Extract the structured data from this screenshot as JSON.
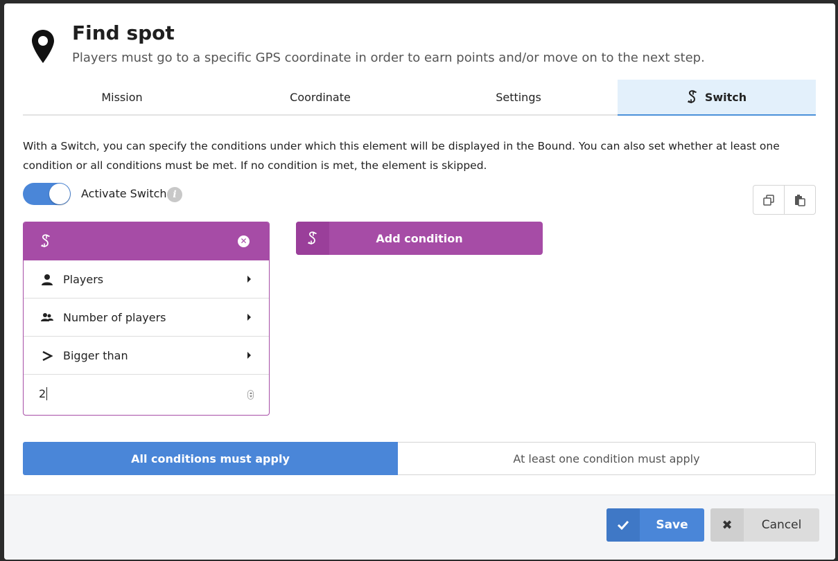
{
  "header": {
    "icon": "map-pin-icon",
    "title": "Find spot",
    "subtitle": "Players must go to a specific GPS coordinate in order to earn points and/or move on to the next step."
  },
  "tabs": [
    {
      "label": "Mission",
      "active": false
    },
    {
      "label": "Coordinate",
      "active": false
    },
    {
      "label": "Settings",
      "active": false
    },
    {
      "label": "Switch",
      "active": true,
      "icon": "switch-icon"
    }
  ],
  "switch": {
    "intro": "With a Switch, you can specify the conditions under which this element will be displayed in the Bound. You can also set whether at least one condition or all conditions must be met. If no condition is met, the element is skipped.",
    "toggle_label": "Activate Switch",
    "toggle_on": true,
    "info_glyph": "i"
  },
  "condition": {
    "rows": [
      {
        "icon": "user-icon",
        "label": "Players"
      },
      {
        "icon": "users-icon",
        "label": "Number of players"
      },
      {
        "icon": "greater-than-icon",
        "label": "Bigger than"
      }
    ],
    "value": "2"
  },
  "add_condition_label": "Add condition",
  "apply_options": {
    "all": "All conditions must apply",
    "any": "At least one condition must apply",
    "selected": "all"
  },
  "footer": {
    "save_label": "Save",
    "cancel_label": "Cancel"
  },
  "colors": {
    "primary": "#4a86d8",
    "condition": "#a64ca6"
  }
}
